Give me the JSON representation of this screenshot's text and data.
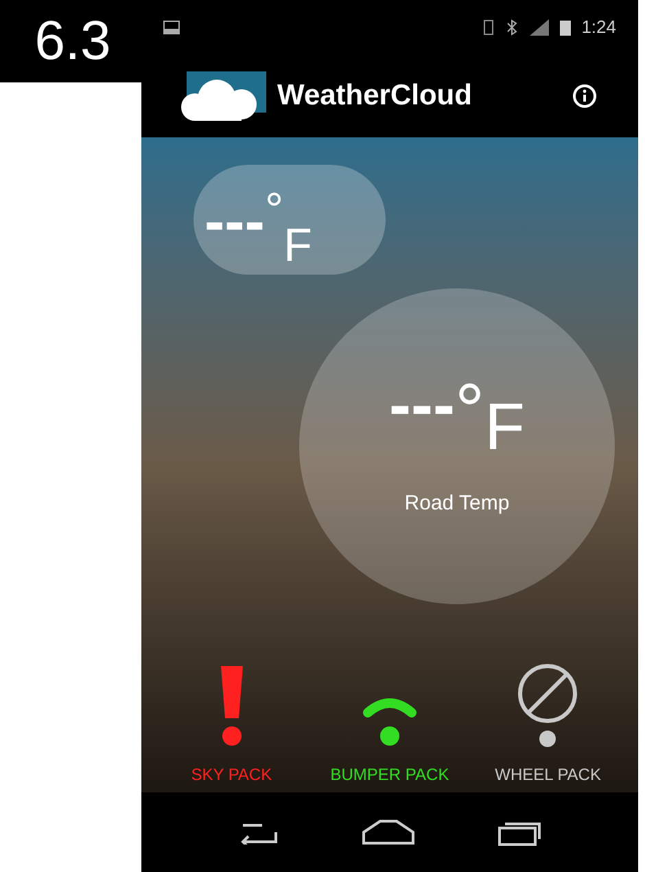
{
  "figure_label": "6.3",
  "status_bar": {
    "time": "1:24"
  },
  "app_bar": {
    "title": "WeatherCloud"
  },
  "sky_temp": {
    "value": "---",
    "degree": "°",
    "unit": "F"
  },
  "road_temp": {
    "value": "---",
    "degree": "°",
    "unit": "F",
    "label": "Road Temp"
  },
  "packs": [
    {
      "kind": "alert",
      "label": "SKY PACK",
      "color": "#ff2020"
    },
    {
      "kind": "signal",
      "label": "BUMPER PACK",
      "color": "#33dd22"
    },
    {
      "kind": "disabled",
      "label": "WHEEL PACK",
      "color": "#c8c8c8"
    }
  ]
}
